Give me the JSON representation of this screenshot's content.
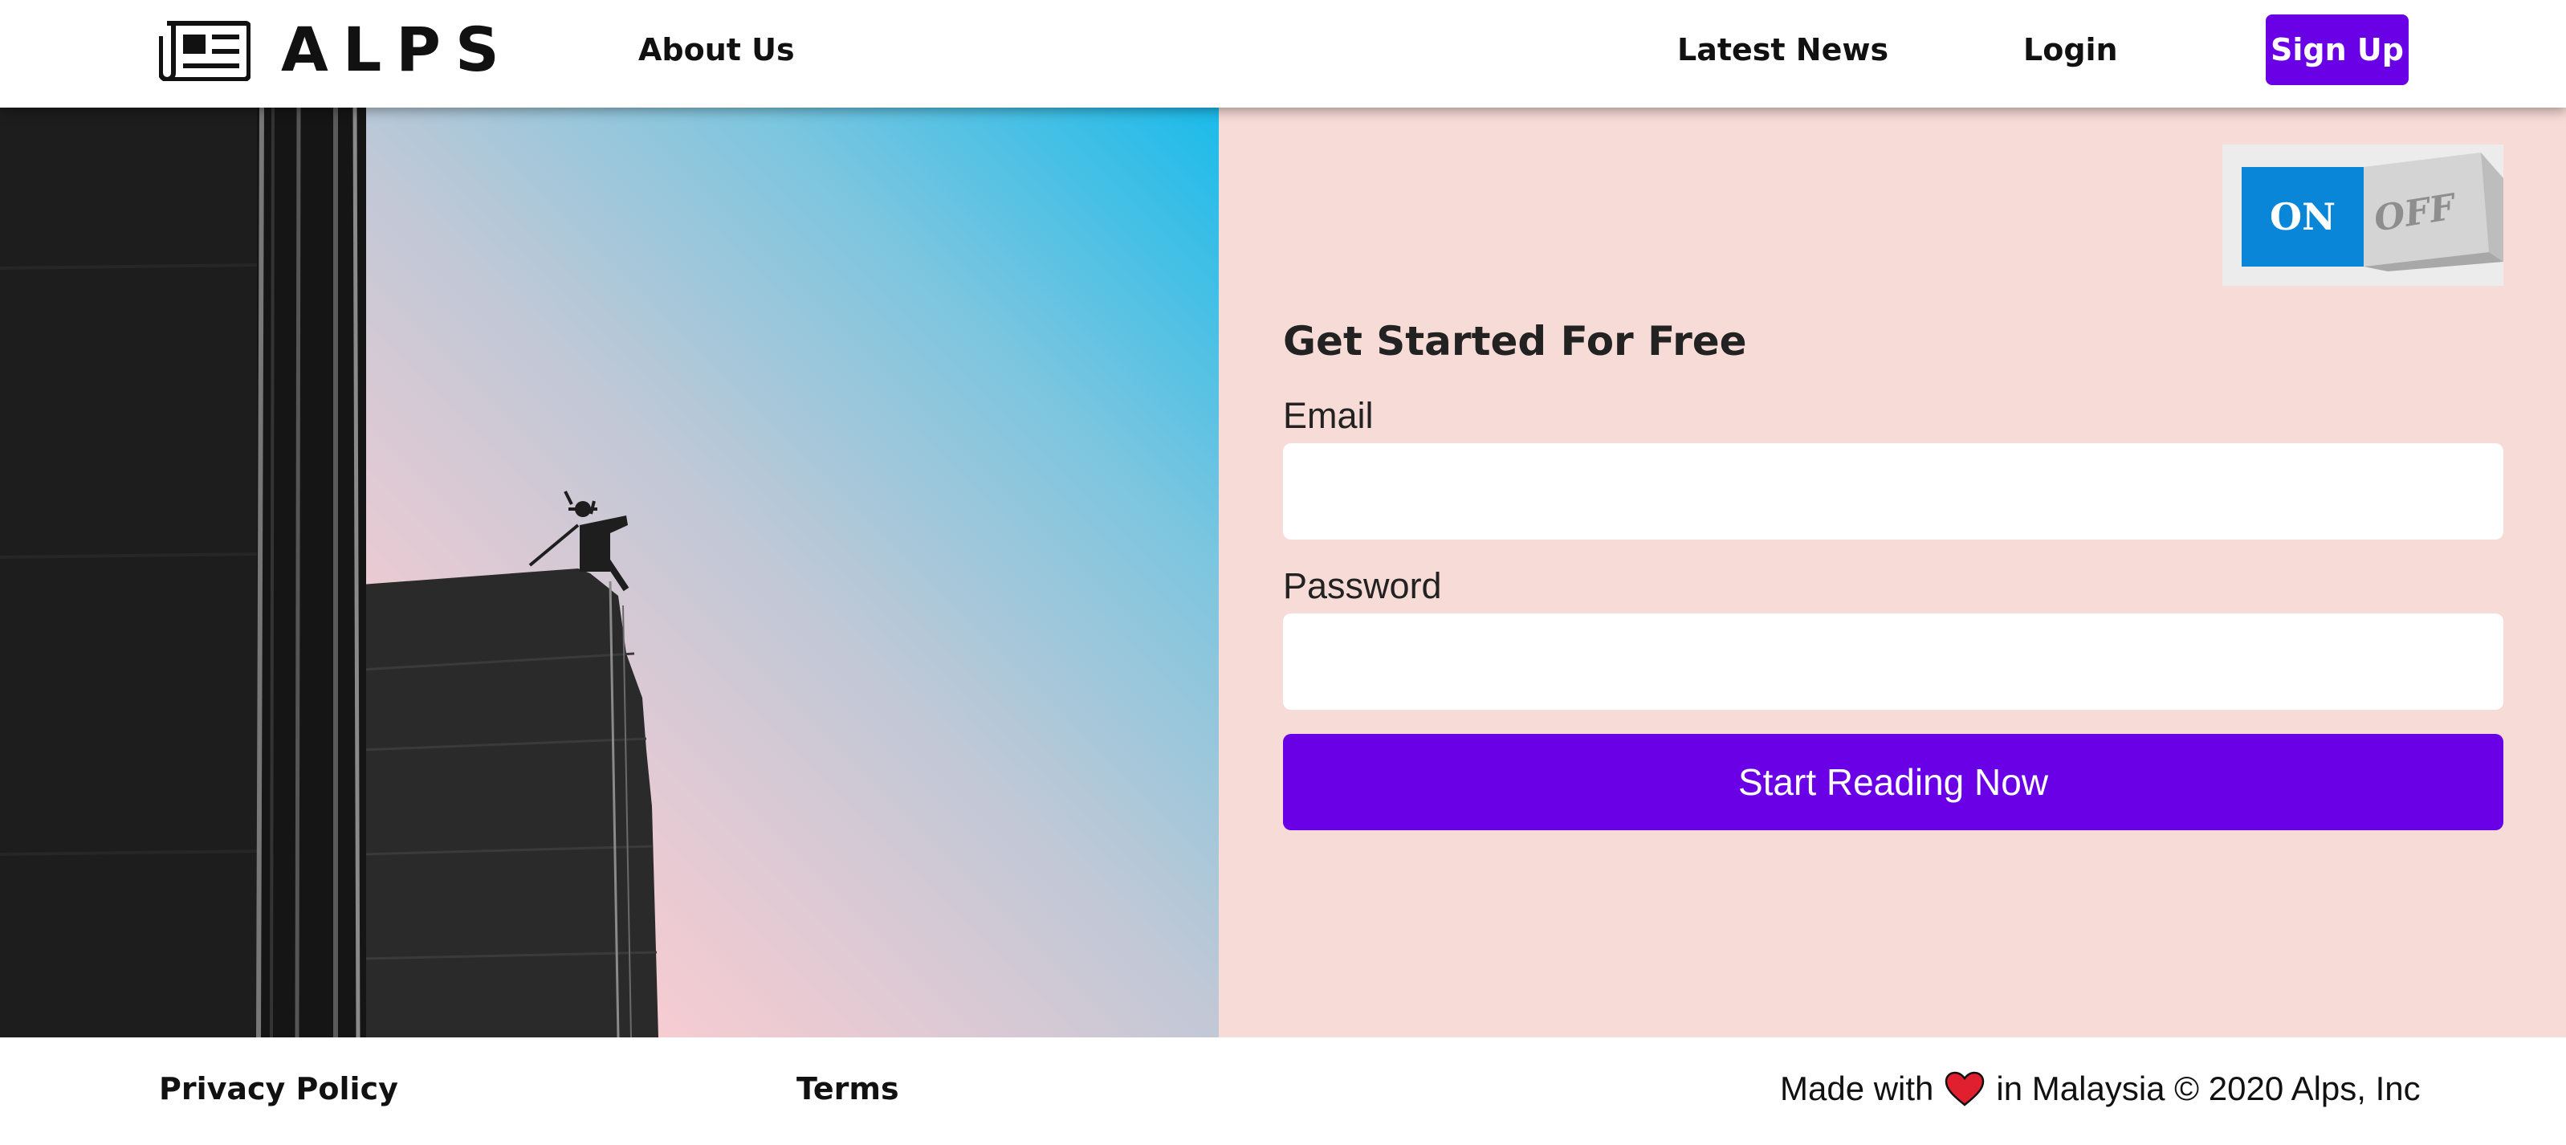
{
  "navbar": {
    "brand": "ALPS",
    "about": "About Us",
    "latest_news": "Latest News",
    "login": "Login",
    "signup": "Sign Up"
  },
  "toggle": {
    "on_label": "ON",
    "off_label": "OFF",
    "state": "on"
  },
  "form": {
    "title": "Get Started For Free",
    "email_label": "Email",
    "email_value": "",
    "password_label": "Password",
    "password_value": "",
    "submit": "Start Reading Now"
  },
  "footer": {
    "privacy": "Privacy Policy",
    "terms": "Terms",
    "made_prefix": "Made with",
    "made_suffix": "in Malaysia © 2020 Alps, Inc"
  },
  "colors": {
    "accent": "#6a00e6",
    "panel_bg": "#f7dbd6",
    "toggle_on": "#0a86d8",
    "heart": "#e0202e"
  },
  "icons": {
    "logo": "newspaper-icon",
    "heart": "heart-icon"
  }
}
